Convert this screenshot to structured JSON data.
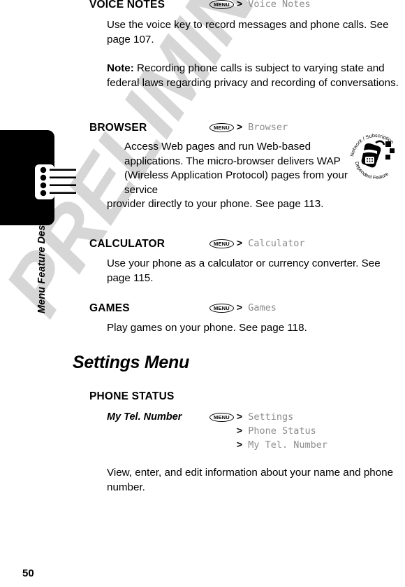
{
  "document": {
    "running_head": "Menu Feature Descriptions",
    "page_number": "50",
    "watermark": "PRELIMINARY"
  },
  "icons": {
    "menu_key_label": "MENU",
    "chevron": ">",
    "feature_icon_top_text": "Network / Subscription",
    "feature_icon_bottom_text": "Dependent Feature"
  },
  "entries": [
    {
      "term": "Voice Notes",
      "path": [
        "Voice Notes"
      ],
      "paragraphs": [
        "Use the voice key to record messages and phone calls. See page 107.",
        "Note: Recording phone calls is subject to varying state and federal laws regarding privacy and recording of conversations."
      ],
      "note_label": "Note:",
      "note_rest": " Recording phone calls is subject to varying state and federal laws regarding privacy and recording of conversations."
    },
    {
      "term": "Browser",
      "path": [
        "Browser"
      ],
      "body_indented": "Access Web pages and run Web-based applications. The micro-browser delivers WAP (Wireless Application Protocol) pages from your service",
      "body_full": " provider directly to your phone. See page 113."
    },
    {
      "term": "Calculator",
      "path": [
        "Calculator"
      ],
      "body": "Use your phone as a calculator or currency converter. See page 115."
    },
    {
      "term": "Games",
      "path": [
        "Games"
      ],
      "body": "Play games on your phone. See page 118."
    }
  ],
  "section": {
    "title": "Settings Menu",
    "group_term": "Phone Status",
    "sub_entry": {
      "term": "My Tel. Number",
      "path": [
        "Settings",
        "Phone Status",
        "My Tel. Number"
      ],
      "body": "View, enter, and edit information about your name and phone number."
    }
  }
}
